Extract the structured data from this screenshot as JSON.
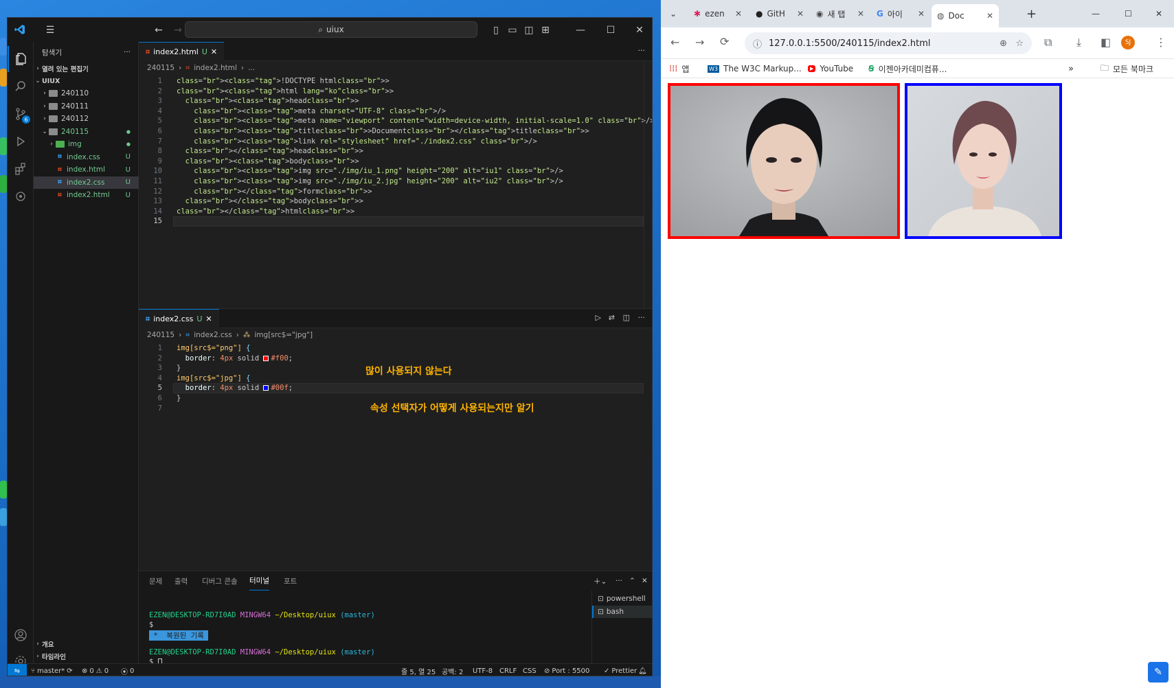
{
  "vscode": {
    "search_text": "uiux",
    "explorer_title": "탐색기",
    "open_editors": "열려 있는 편집기",
    "workspace": "UIUX",
    "tree": [
      {
        "label": "240110",
        "type": "folder",
        "badge": ""
      },
      {
        "label": "240111",
        "type": "folder",
        "badge": ""
      },
      {
        "label": "240112",
        "type": "folder",
        "badge": ""
      },
      {
        "label": "240115",
        "type": "folder-open",
        "badge": "●"
      },
      {
        "label": "img",
        "type": "folder",
        "badge": "●"
      },
      {
        "label": "index.css",
        "type": "css",
        "badge": "U"
      },
      {
        "label": "index.html",
        "type": "html",
        "badge": "U"
      },
      {
        "label": "index2.css",
        "type": "css",
        "badge": "U"
      },
      {
        "label": "index2.html",
        "type": "html",
        "badge": "U"
      }
    ],
    "outline": "개요",
    "timeline": "타임라인",
    "scm_badge": "6",
    "editor1": {
      "tab_label": "index2.html",
      "tab_status": "U",
      "crumbs": [
        "240115",
        "index2.html",
        "..."
      ],
      "lines": [
        "<!DOCTYPE html>",
        "<html lang=\"ko\">",
        "  <head>",
        "    <meta charset=\"UTF-8\" />",
        "    <meta name=\"viewport\" content=\"width=device-width, initial-scale=1.0\" />",
        "    <title>Document</title>",
        "    <link rel=\"stylesheet\" href=\"./index2.css\" />",
        "  </head>",
        "  <body>",
        "    <img src=\"./img/iu_1.png\" height=\"200\" alt=\"iu1\" />",
        "    <img src=\"./img/iu_2.jpg\" height=\"200\" alt=\"iu2\" />",
        "    </form>",
        "  </body>",
        "</html>",
        ""
      ]
    },
    "editor2": {
      "tab_label": "index2.css",
      "tab_status": "U",
      "crumbs": [
        "240115",
        "index2.css",
        "img[src$=\"jpg\"]"
      ],
      "lines": [
        "img[src$=\"png\"] {",
        "  border: 4px solid #f00;",
        "}",
        "img[src$=\"jpg\"] {",
        "  border: 4px solid #00f;",
        "}",
        ""
      ],
      "annotation1": "많이 사용되지 않는다",
      "annotation2": "속성 선택자가 어떻게 사용되는지만 알기"
    },
    "panel": {
      "tabs": [
        "문제",
        "출력",
        "디버그 콘솔",
        "터미널",
        "포트"
      ],
      "active_tab": "터미널",
      "terminals": [
        "powershell",
        "bash"
      ],
      "prompt_user": "EZEN@DESKTOP-RD7I0AD",
      "prompt_env": "MINGW64",
      "prompt_path": "~/Desktop/uiux",
      "prompt_branch": "(master)",
      "dollar": "$",
      "restored": " *  복원된 기록 "
    },
    "status": {
      "branch": "master*",
      "errors": "0",
      "warnings": "0",
      "ports": "0",
      "position": "줄 5, 열 25",
      "spaces": "공백: 2",
      "encoding": "UTF-8",
      "eol": "CRLF",
      "language": "CSS",
      "port": "Port : 5500",
      "prettier": "Prettier"
    }
  },
  "chrome": {
    "tabs": [
      {
        "label": "ezen",
        "icon": "slack-icon"
      },
      {
        "label": "GitH",
        "icon": "github-icon"
      },
      {
        "label": "새 탭",
        "icon": "chrome-icon"
      },
      {
        "label": "아이",
        "icon": "google-icon"
      },
      {
        "label": "Doc",
        "icon": "globe-icon"
      }
    ],
    "url": "127.0.0.1:5500/240115/index2.html",
    "profile": "SJ",
    "bookmarks": [
      "앱",
      "The W3C Markup...",
      "YouTube",
      "이젠아카데미컴퓨..."
    ],
    "bookmarks_all": "모든 북마크",
    "image1_alt": "iu1",
    "image2_alt": "iu2",
    "image1_border": "#ff0000",
    "image2_border": "#0000ff"
  }
}
